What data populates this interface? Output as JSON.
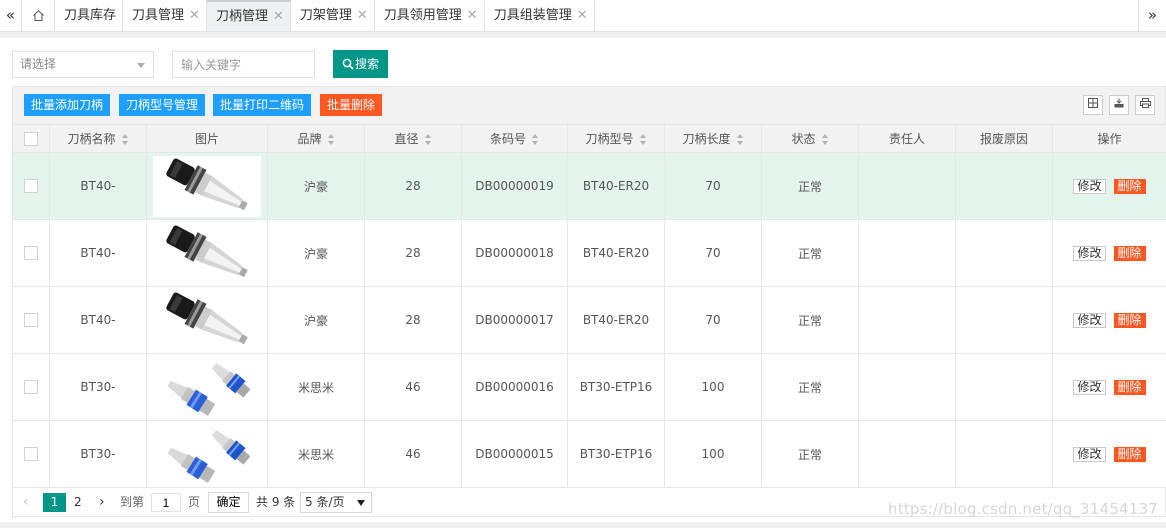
{
  "tabbar": {
    "prev_icon": "double-chevron-left-icon",
    "next_icon": "double-chevron-right-icon",
    "home_icon": "home-icon",
    "tabs": [
      {
        "label": "刀具库存",
        "closable": false,
        "active": false
      },
      {
        "label": "刀具管理",
        "closable": true,
        "active": false
      },
      {
        "label": "刀柄管理",
        "closable": true,
        "active": true
      },
      {
        "label": "刀架管理",
        "closable": true,
        "active": false
      },
      {
        "label": "刀具领用管理",
        "closable": true,
        "active": false
      },
      {
        "label": "刀具组装管理",
        "closable": true,
        "active": false
      }
    ]
  },
  "search": {
    "select_placeholder": "请选择",
    "keyword_placeholder": "输入关键字",
    "search_label": "搜索"
  },
  "toolbar": {
    "batch_add_label": "批量添加刀柄",
    "model_manage_label": "刀柄型号管理",
    "print_qr_label": "批量打印二维码",
    "batch_delete_label": "批量删除",
    "icons": [
      "columns-icon",
      "export-icon",
      "print-icon"
    ]
  },
  "table": {
    "headers": [
      "刀柄名称",
      "图片",
      "品牌",
      "直径",
      "条码号",
      "刀柄型号",
      "刀柄长度",
      "状态",
      "责任人",
      "报废原因",
      "操作"
    ],
    "edit_label": "修改",
    "delete_label": "删除",
    "rows": [
      {
        "name": "BT40-",
        "image": "bt40-holder",
        "brand": "沪豪",
        "diameter": "28",
        "barcode": "DB00000019",
        "model": "BT40-ER20",
        "length": "70",
        "status": "正常",
        "owner": "",
        "reason": ""
      },
      {
        "name": "BT40-",
        "image": "bt40-holder",
        "brand": "沪豪",
        "diameter": "28",
        "barcode": "DB00000018",
        "model": "BT40-ER20",
        "length": "70",
        "status": "正常",
        "owner": "",
        "reason": ""
      },
      {
        "name": "BT40-",
        "image": "bt40-holder",
        "brand": "沪豪",
        "diameter": "28",
        "barcode": "DB00000017",
        "model": "BT40-ER20",
        "length": "70",
        "status": "正常",
        "owner": "",
        "reason": ""
      },
      {
        "name": "BT30-",
        "image": "bt30-holder",
        "brand": "米思米",
        "diameter": "46",
        "barcode": "DB00000016",
        "model": "BT30-ETP16",
        "length": "100",
        "status": "正常",
        "owner": "",
        "reason": ""
      },
      {
        "name": "BT30-",
        "image": "bt30-holder",
        "brand": "米思米",
        "diameter": "46",
        "barcode": "DB00000015",
        "model": "BT30-ETP16",
        "length": "100",
        "status": "正常",
        "owner": "",
        "reason": ""
      }
    ]
  },
  "pager": {
    "prev": "‹",
    "page1": "1",
    "page2": "2",
    "next": "›",
    "goto_label": "到第",
    "goto_value": "1",
    "page_unit": "页",
    "confirm_label": "确定",
    "total_label": "共 9 条",
    "page_size_label": "5 条/页"
  },
  "watermark": "https://blog.csdn.net/qq_31454137",
  "colors": {
    "teal": "#009688",
    "blue": "#1e9fff",
    "orange": "#ff5722",
    "highlight_row": "#e3f4ed"
  }
}
